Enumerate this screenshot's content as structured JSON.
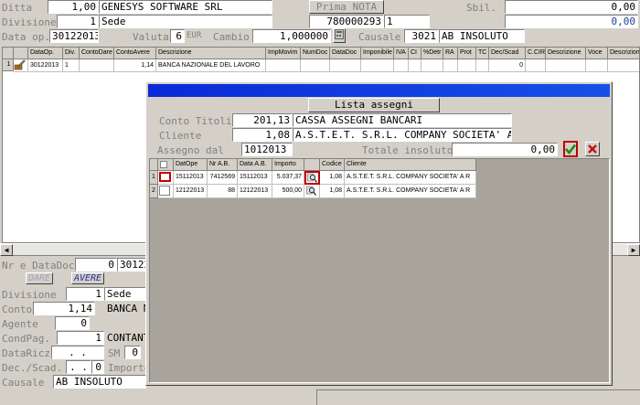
{
  "header": {
    "ditta_label": "Ditta",
    "ditta_code": "1,00",
    "ditta_name": "GENESYS SOFTWARE SRL",
    "primanota_label": "Prima NOTA",
    "sbil_label": "Sbil.",
    "sbil_value1": "0,00",
    "sbil_value2": "0,00",
    "divisione_label": "Divisione",
    "divisione_code": "1",
    "divisione_name": "Sede",
    "reg_number": "780000293",
    "reg_count": "1",
    "dataop_label": "Data op.",
    "dataop_value": "30122013",
    "valuta_label": "Valuta",
    "valuta_value": "6",
    "currency": "EUR",
    "cambio_label": "Cambio",
    "cambio_value": "1,000000",
    "causale_label": "Causale",
    "causale_code": "3021",
    "causale_name": "AB INSOLUTO"
  },
  "main_grid": {
    "columns": [
      "DataOp.",
      "Div.",
      "ContoDare",
      "ContoAvere",
      "Descrizione",
      "ImpMovim",
      "NumDoc",
      "DataDoc",
      "Imponibile",
      "IVA",
      "CI",
      "%Detr",
      "RA",
      "Prot",
      "TC",
      "Dec/Scad",
      "C.CIR",
      "Descrizione",
      "Voce",
      "Descrizion"
    ],
    "row": {
      "num": "1",
      "dataop": "30122013",
      "div": "1",
      "contodare": "",
      "contoavere": "1,14",
      "descrizione": "BANCA NAZIONALE DEL LAVORO",
      "decscad": "0"
    }
  },
  "lower_form": {
    "nr_datadoc_label": "Nr e DataDoc",
    "nr_value": "0",
    "datadoc_value": "30122",
    "dare_label": "DARE",
    "avere_label": "AVERE",
    "divisione_label": "Divisione",
    "divisione_code": "1",
    "divisione_name": "Sede",
    "conto_label": "Conto",
    "conto_code": "1,14",
    "conto_name": "BANCA N",
    "agente_label": "Agente",
    "agente_value": "0",
    "condpag_label": "CondPag.",
    "condpag_code": "1",
    "condpag_name": "CONTANT",
    "dataricz_label": "DataRicz",
    "dataricz_value": ". .",
    "sm_label": "SM",
    "sm_value": "0",
    "decscad_label": "Dec./Scad.",
    "decscad_value": ". .",
    "decscad_num": "0",
    "importo_label": "Importo",
    "causale_label": "Causale",
    "causale_value": "AB INSOLUTO"
  },
  "dialog": {
    "lista_button": "Lista assegni",
    "conto_titoli_label": "Conto Titoli",
    "conto_titoli_code": "201,13",
    "conto_titoli_name": "CASSA ASSEGNI BANCARI",
    "cliente_label": "Cliente",
    "cliente_code": "1,08",
    "cliente_name": "A.S.T.E.T. S.R.L. COMPANY SOCIETA' A R",
    "assegno_label": "Assegno dal",
    "assegno_value": "1012013",
    "totale_label": "Totale insoluto",
    "totale_value": "0,00",
    "columns": [
      "",
      "DatOpe",
      "Nr A.B.",
      "Data A.B.",
      "Importo",
      "",
      "Codice",
      "Cliente"
    ],
    "rows": [
      {
        "num": "1",
        "datope": "15112013",
        "nrab": "7412569",
        "dataab": "15112013",
        "importo": "5.037,37",
        "codice": "1,08",
        "cliente": "A.S.T.E.T. S.R.L. COMPANY SOCIETA' A R"
      },
      {
        "num": "2",
        "datope": "12122013",
        "nrab": "88",
        "dataab": "12122013",
        "importo": "500,00",
        "codice": "1,08",
        "cliente": "A.S.T.E.T. S.R.L. COMPANY SOCIETA' A R"
      }
    ]
  },
  "icons": {
    "confirm": "check-icon",
    "cancel": "x-icon",
    "lookup": "magnifier-icon",
    "row_edit": "pencil-icon",
    "calc": "calculator-icon"
  }
}
